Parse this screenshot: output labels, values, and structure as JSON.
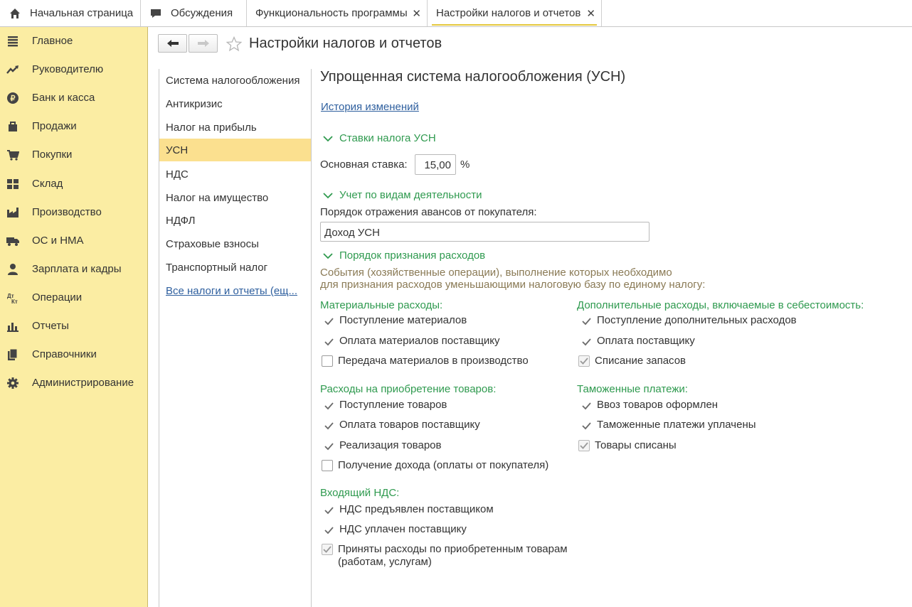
{
  "tabs": [
    {
      "label": "Начальная страница",
      "icon": "home-icon"
    },
    {
      "label": "Обсуждения",
      "icon": "chat-bubble-icon"
    },
    {
      "label": "Функциональность программы",
      "icon": "",
      "close": "✕"
    },
    {
      "label": "Настройки налогов и отчетов",
      "icon": "",
      "close": "✕",
      "active": true
    }
  ],
  "sidebar": {
    "items": [
      {
        "label": "Главное",
        "icon": "menu-lines-icon"
      },
      {
        "label": "Руководителю",
        "icon": "trend-up-icon"
      },
      {
        "label": "Банк и касса",
        "icon": "ruble-coin-icon"
      },
      {
        "label": "Продажи",
        "icon": "shopping-bag-icon"
      },
      {
        "label": "Покупки",
        "icon": "shopping-cart-icon"
      },
      {
        "label": "Склад",
        "icon": "warehouse-grid-icon"
      },
      {
        "label": "Производство",
        "icon": "factory-icon"
      },
      {
        "label": "ОС и НМА",
        "icon": "truck-icon"
      },
      {
        "label": "Зарплата и кадры",
        "icon": "person-icon"
      },
      {
        "label": "Операции",
        "icon": "dt-kt-icon"
      },
      {
        "label": "Отчеты",
        "icon": "bar-chart-icon"
      },
      {
        "label": "Справочники",
        "icon": "books-icon"
      },
      {
        "label": "Администрирование",
        "icon": "gear-icon"
      }
    ]
  },
  "header": {
    "title": "Настройки налогов и отчетов",
    "back_icon": "arrow-left-icon",
    "forward_icon": "arrow-right-icon",
    "favorite_icon": "star-outline-icon"
  },
  "nav": {
    "items": [
      {
        "label": "Система налогообложения"
      },
      {
        "label": "Антикризис"
      },
      {
        "label": "Налог на прибыль"
      },
      {
        "label": "УСН",
        "selected": true
      },
      {
        "label": "НДС"
      },
      {
        "label": "Налог на имущество"
      },
      {
        "label": "НДФЛ"
      },
      {
        "label": "Страховые взносы"
      },
      {
        "label": "Транспортный налог"
      },
      {
        "label": "Все налоги и отчеты (ещ...",
        "link": true
      }
    ]
  },
  "content": {
    "title": "Упрощенная система налогообложения (УСН)",
    "history_link": "История изменений",
    "rates": {
      "header": "Ставки налога УСН",
      "main_rate_label": "Основная ставка:",
      "main_rate_value": "15,00",
      "percent_sign": "%"
    },
    "activity": {
      "header": "Учет по видам деятельности",
      "advance_label": "Порядок отражения авансов от покупателя:",
      "advance_value": "Доход УСН"
    },
    "expenses": {
      "header": "Порядок признания расходов",
      "description_line1": "События (хозяйственные операции), выполнение которых необходимо",
      "description_line2": "для признания расходов уменьшающими налоговую базу по единому налогу:",
      "groups": {
        "material": {
          "title": "Материальные расходы:",
          "items": [
            {
              "label": "Поступление материалов",
              "state": "fixed"
            },
            {
              "label": "Оплата материалов поставщику",
              "state": "fixed"
            },
            {
              "label": "Передача материалов в производство",
              "state": "unchecked"
            }
          ]
        },
        "goods": {
          "title": "Расходы на приобретение товаров:",
          "items": [
            {
              "label": "Поступление товаров",
              "state": "fixed"
            },
            {
              "label": "Оплата товаров поставщику",
              "state": "fixed"
            },
            {
              "label": "Реализация товаров",
              "state": "fixed"
            },
            {
              "label": "Получение дохода (оплаты от покупателя)",
              "state": "unchecked"
            }
          ]
        },
        "vat": {
          "title": "Входящий НДС:",
          "items": [
            {
              "label": "НДС предъявлен поставщиком",
              "state": "fixed"
            },
            {
              "label": "НДС уплачен поставщику",
              "state": "fixed"
            },
            {
              "label": "Приняты расходы по приобретенным товарам",
              "label2": "(работам, услугам)",
              "state": "checked-disabled"
            }
          ]
        },
        "additional": {
          "title": "Дополнительные расходы, включаемые в себестоимость:",
          "items": [
            {
              "label": "Поступление дополнительных расходов",
              "state": "fixed"
            },
            {
              "label": "Оплата поставщику",
              "state": "fixed"
            },
            {
              "label": "Списание запасов",
              "state": "checked-disabled"
            }
          ]
        },
        "customs": {
          "title": "Таможенные платежи:",
          "items": [
            {
              "label": "Ввоз товаров оформлен",
              "state": "fixed"
            },
            {
              "label": "Таможенные платежи уплачены",
              "state": "fixed"
            },
            {
              "label": "Товары списаны",
              "state": "checked-disabled"
            }
          ]
        }
      }
    }
  },
  "colors": {
    "sidebar_bg": "#fbeda3",
    "selected_bg": "#fbe08f",
    "group_green": "#2f9a4f",
    "link_blue": "#2e5f9e",
    "description": "#8a7a55"
  }
}
